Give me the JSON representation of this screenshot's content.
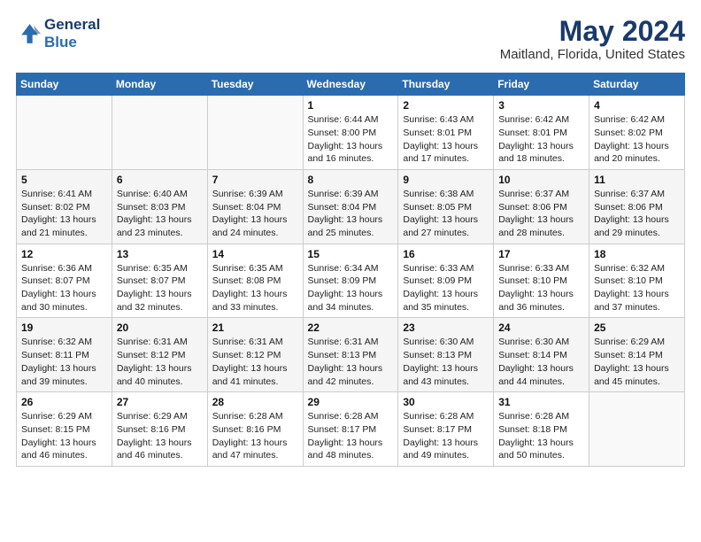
{
  "header": {
    "logo_line1": "General",
    "logo_line2": "Blue",
    "main_title": "May 2024",
    "subtitle": "Maitland, Florida, United States"
  },
  "days_of_week": [
    "Sunday",
    "Monday",
    "Tuesday",
    "Wednesday",
    "Thursday",
    "Friday",
    "Saturday"
  ],
  "weeks": [
    [
      {
        "day": "",
        "info": ""
      },
      {
        "day": "",
        "info": ""
      },
      {
        "day": "",
        "info": ""
      },
      {
        "day": "1",
        "info": "Sunrise: 6:44 AM\nSunset: 8:00 PM\nDaylight: 13 hours\nand 16 minutes."
      },
      {
        "day": "2",
        "info": "Sunrise: 6:43 AM\nSunset: 8:01 PM\nDaylight: 13 hours\nand 17 minutes."
      },
      {
        "day": "3",
        "info": "Sunrise: 6:42 AM\nSunset: 8:01 PM\nDaylight: 13 hours\nand 18 minutes."
      },
      {
        "day": "4",
        "info": "Sunrise: 6:42 AM\nSunset: 8:02 PM\nDaylight: 13 hours\nand 20 minutes."
      }
    ],
    [
      {
        "day": "5",
        "info": "Sunrise: 6:41 AM\nSunset: 8:02 PM\nDaylight: 13 hours\nand 21 minutes."
      },
      {
        "day": "6",
        "info": "Sunrise: 6:40 AM\nSunset: 8:03 PM\nDaylight: 13 hours\nand 23 minutes."
      },
      {
        "day": "7",
        "info": "Sunrise: 6:39 AM\nSunset: 8:04 PM\nDaylight: 13 hours\nand 24 minutes."
      },
      {
        "day": "8",
        "info": "Sunrise: 6:39 AM\nSunset: 8:04 PM\nDaylight: 13 hours\nand 25 minutes."
      },
      {
        "day": "9",
        "info": "Sunrise: 6:38 AM\nSunset: 8:05 PM\nDaylight: 13 hours\nand 27 minutes."
      },
      {
        "day": "10",
        "info": "Sunrise: 6:37 AM\nSunset: 8:06 PM\nDaylight: 13 hours\nand 28 minutes."
      },
      {
        "day": "11",
        "info": "Sunrise: 6:37 AM\nSunset: 8:06 PM\nDaylight: 13 hours\nand 29 minutes."
      }
    ],
    [
      {
        "day": "12",
        "info": "Sunrise: 6:36 AM\nSunset: 8:07 PM\nDaylight: 13 hours\nand 30 minutes."
      },
      {
        "day": "13",
        "info": "Sunrise: 6:35 AM\nSunset: 8:07 PM\nDaylight: 13 hours\nand 32 minutes."
      },
      {
        "day": "14",
        "info": "Sunrise: 6:35 AM\nSunset: 8:08 PM\nDaylight: 13 hours\nand 33 minutes."
      },
      {
        "day": "15",
        "info": "Sunrise: 6:34 AM\nSunset: 8:09 PM\nDaylight: 13 hours\nand 34 minutes."
      },
      {
        "day": "16",
        "info": "Sunrise: 6:33 AM\nSunset: 8:09 PM\nDaylight: 13 hours\nand 35 minutes."
      },
      {
        "day": "17",
        "info": "Sunrise: 6:33 AM\nSunset: 8:10 PM\nDaylight: 13 hours\nand 36 minutes."
      },
      {
        "day": "18",
        "info": "Sunrise: 6:32 AM\nSunset: 8:10 PM\nDaylight: 13 hours\nand 37 minutes."
      }
    ],
    [
      {
        "day": "19",
        "info": "Sunrise: 6:32 AM\nSunset: 8:11 PM\nDaylight: 13 hours\nand 39 minutes."
      },
      {
        "day": "20",
        "info": "Sunrise: 6:31 AM\nSunset: 8:12 PM\nDaylight: 13 hours\nand 40 minutes."
      },
      {
        "day": "21",
        "info": "Sunrise: 6:31 AM\nSunset: 8:12 PM\nDaylight: 13 hours\nand 41 minutes."
      },
      {
        "day": "22",
        "info": "Sunrise: 6:31 AM\nSunset: 8:13 PM\nDaylight: 13 hours\nand 42 minutes."
      },
      {
        "day": "23",
        "info": "Sunrise: 6:30 AM\nSunset: 8:13 PM\nDaylight: 13 hours\nand 43 minutes."
      },
      {
        "day": "24",
        "info": "Sunrise: 6:30 AM\nSunset: 8:14 PM\nDaylight: 13 hours\nand 44 minutes."
      },
      {
        "day": "25",
        "info": "Sunrise: 6:29 AM\nSunset: 8:14 PM\nDaylight: 13 hours\nand 45 minutes."
      }
    ],
    [
      {
        "day": "26",
        "info": "Sunrise: 6:29 AM\nSunset: 8:15 PM\nDaylight: 13 hours\nand 46 minutes."
      },
      {
        "day": "27",
        "info": "Sunrise: 6:29 AM\nSunset: 8:16 PM\nDaylight: 13 hours\nand 46 minutes."
      },
      {
        "day": "28",
        "info": "Sunrise: 6:28 AM\nSunset: 8:16 PM\nDaylight: 13 hours\nand 47 minutes."
      },
      {
        "day": "29",
        "info": "Sunrise: 6:28 AM\nSunset: 8:17 PM\nDaylight: 13 hours\nand 48 minutes."
      },
      {
        "day": "30",
        "info": "Sunrise: 6:28 AM\nSunset: 8:17 PM\nDaylight: 13 hours\nand 49 minutes."
      },
      {
        "day": "31",
        "info": "Sunrise: 6:28 AM\nSunset: 8:18 PM\nDaylight: 13 hours\nand 50 minutes."
      },
      {
        "day": "",
        "info": ""
      }
    ]
  ]
}
